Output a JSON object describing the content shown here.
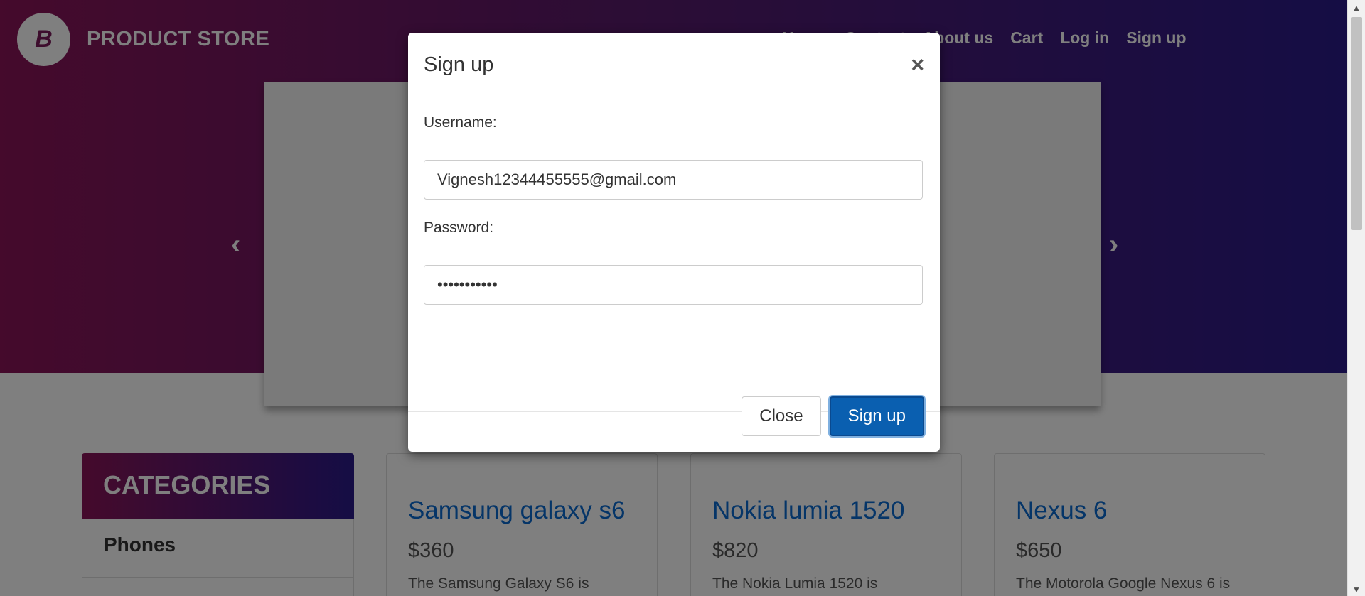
{
  "brand": {
    "name": "PRODUCT STORE",
    "logo_letter": "B"
  },
  "nav": {
    "items": [
      "Home",
      "Contact",
      "About us",
      "Cart",
      "Log in",
      "Sign up"
    ]
  },
  "carousel": {
    "prev": "‹",
    "next": "›"
  },
  "categories": {
    "header": "CATEGORIES",
    "items": [
      "Phones"
    ]
  },
  "products": [
    {
      "title": "Samsung galaxy s6",
      "price": "$360",
      "desc": "The Samsung Galaxy S6 is"
    },
    {
      "title": "Nokia lumia 1520",
      "price": "$820",
      "desc": "The Nokia Lumia 1520 is"
    },
    {
      "title": "Nexus 6",
      "price": "$650",
      "desc": "The Motorola Google Nexus 6 is"
    }
  ],
  "modal": {
    "title": "Sign up",
    "close_icon": "×",
    "username_label": "Username:",
    "username_value": "Vignesh12344455555@gmail.com",
    "password_label": "Password:",
    "password_value": "•••••••••••",
    "close_button": "Close",
    "signup_button": "Sign up"
  }
}
